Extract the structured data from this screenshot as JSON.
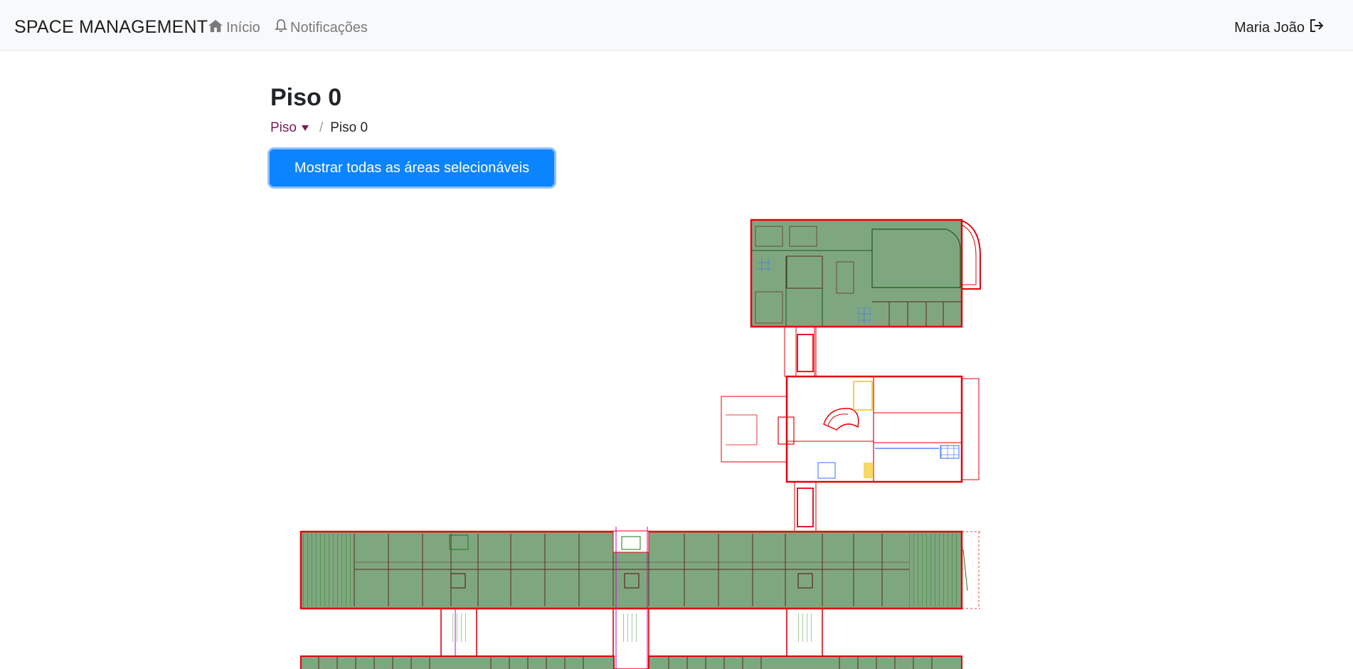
{
  "navbar": {
    "brand": "SPACE MANAGEMENT",
    "home_label": "Início",
    "notifications_label": "Notificações",
    "user_name": "Maria João",
    "home_icon": "home-icon",
    "bell_icon": "bell-icon",
    "logout_icon": "logout-icon"
  },
  "page": {
    "title": "Piso 0",
    "breadcrumb": {
      "parent": "Piso",
      "current": "Piso 0"
    },
    "show_areas_button": "Mostrar todas as áreas selecionáveis"
  },
  "floor_plan": {
    "selectable_fill": "#7fa77f",
    "wall_color": "#e8000b",
    "accent_colors": [
      "#1a7a1a",
      "#2f6fff",
      "#d100d1",
      "#f0c000"
    ]
  }
}
